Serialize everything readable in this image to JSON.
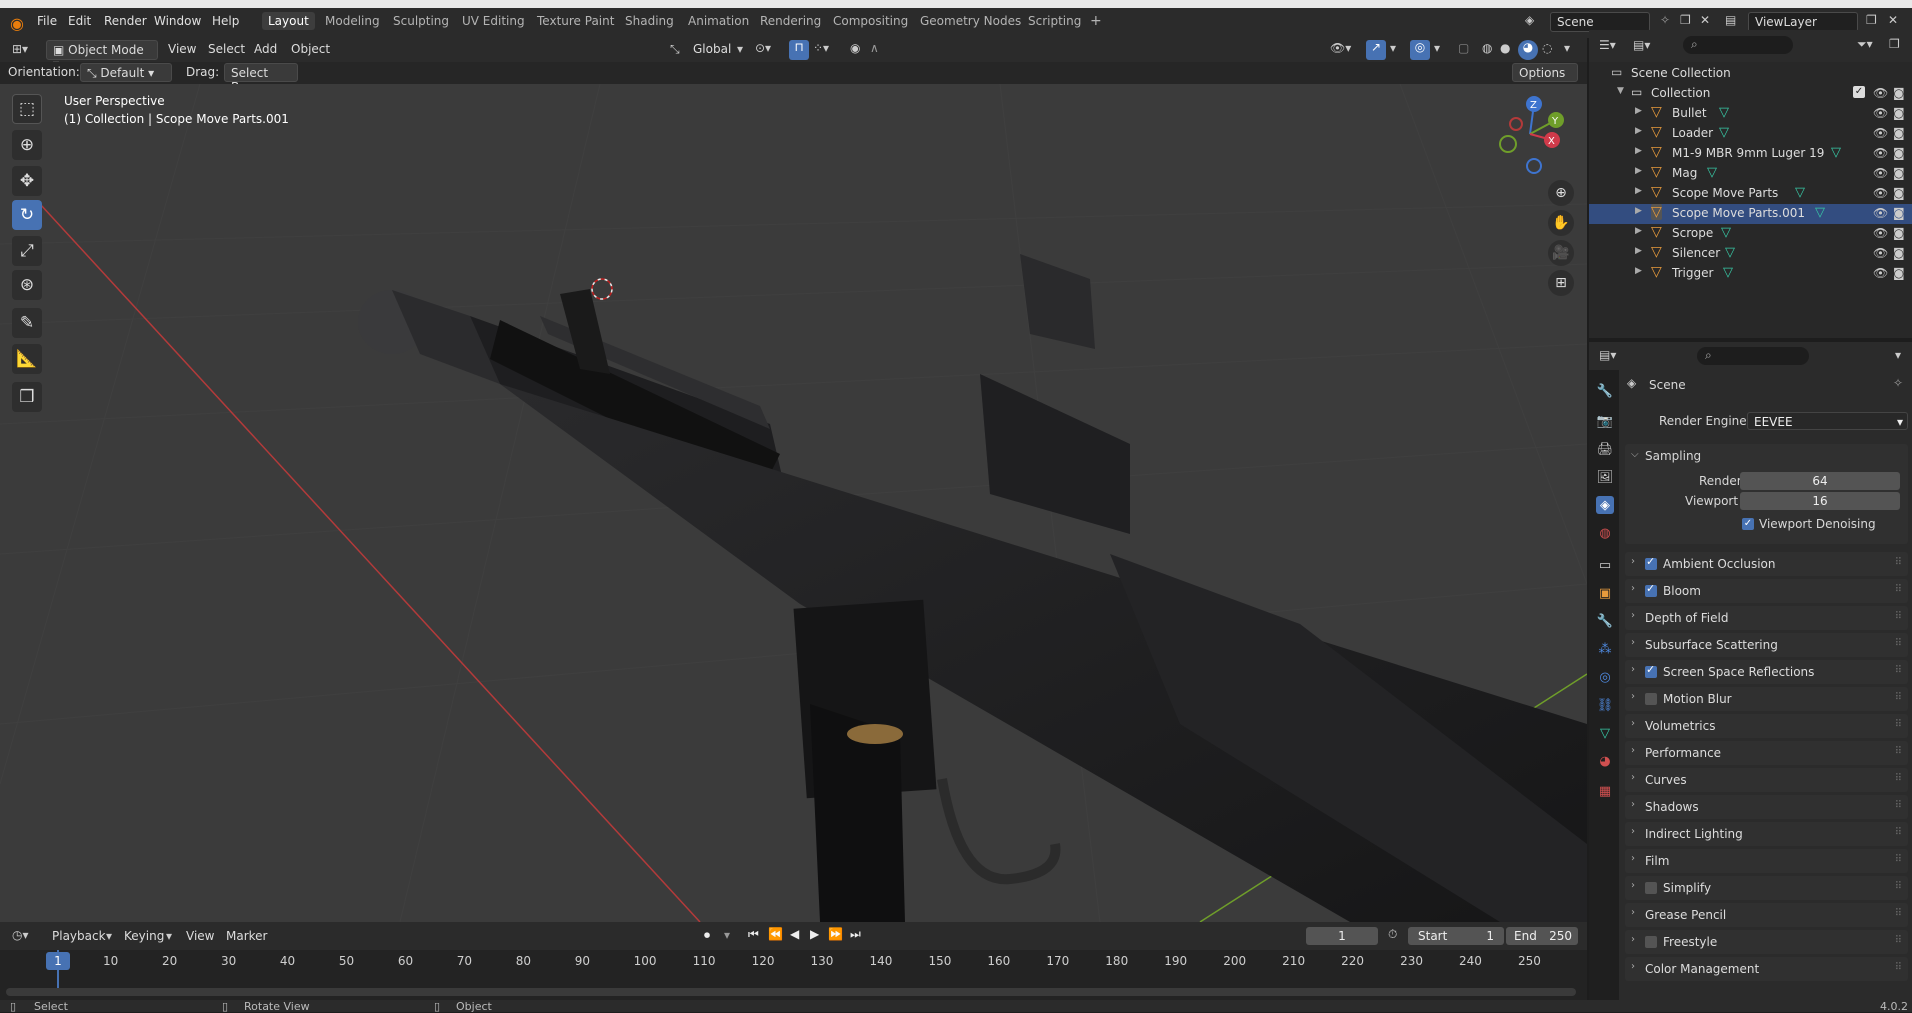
{
  "app": {
    "title": "Blender"
  },
  "menus": [
    "File",
    "Edit",
    "Render",
    "Window",
    "Help"
  ],
  "workspaces": [
    "Layout",
    "Modeling",
    "Sculpting",
    "UV Editing",
    "Texture Paint",
    "Shading",
    "Animation",
    "Rendering",
    "Compositing",
    "Geometry Nodes",
    "Scripting"
  ],
  "active_workspace": "Layout",
  "scene": {
    "name": "Scene",
    "view_layer": "ViewLayer"
  },
  "viewport_header": {
    "mode": "Object Mode",
    "menus": [
      "View",
      "Select",
      "Add",
      "Object"
    ],
    "transform_orientation": "Global",
    "orientation_label": "Orientation:",
    "orientation_value": "Default",
    "drag_label": "Drag:",
    "drag_value": "Select Box",
    "options": "Options"
  },
  "viewport": {
    "perspective": "User Perspective",
    "context": "(1) Collection | Scope Move Parts.001",
    "gizmo": {
      "z": "Z",
      "y": "Y",
      "x": "X"
    }
  },
  "tools": [
    "select-box-icon",
    "cursor-icon",
    "move-icon",
    "rotate-icon",
    "scale-icon",
    "transform-icon",
    "annotate-icon",
    "measure-icon",
    "add-cube-icon"
  ],
  "active_tool": "rotate-icon",
  "outliner": {
    "root": "Scene Collection",
    "collection": "Collection",
    "items": [
      {
        "name": "Bullet"
      },
      {
        "name": "Loader"
      },
      {
        "name": "M1-9 MBR 9mm Luger 19"
      },
      {
        "name": "Mag"
      },
      {
        "name": "Scope Move Parts"
      },
      {
        "name": "Scope Move Parts.001"
      },
      {
        "name": "Scrope"
      },
      {
        "name": "Silencer"
      },
      {
        "name": "Trigger"
      }
    ],
    "active_item": "Scope Move Parts.001"
  },
  "properties": {
    "context": "Scene",
    "render_engine_label": "Render Engine",
    "render_engine": "EEVEE",
    "sampling": {
      "label": "Sampling",
      "render_label": "Render",
      "render_value": "64",
      "viewport_label": "Viewport",
      "viewport_value": "16",
      "denoise_label": "Viewport Denoising",
      "denoise_checked": true
    },
    "panels": [
      {
        "label": "Ambient Occlusion",
        "checkbox": true,
        "checked": true
      },
      {
        "label": "Bloom",
        "checkbox": true,
        "checked": true
      },
      {
        "label": "Depth of Field",
        "checkbox": false,
        "checked": false
      },
      {
        "label": "Subsurface Scattering",
        "checkbox": false,
        "checked": false
      },
      {
        "label": "Screen Space Reflections",
        "checkbox": true,
        "checked": true
      },
      {
        "label": "Motion Blur",
        "checkbox": true,
        "checked": false
      },
      {
        "label": "Volumetrics",
        "checkbox": false,
        "checked": false
      },
      {
        "label": "Performance",
        "checkbox": false,
        "checked": false
      },
      {
        "label": "Curves",
        "checkbox": false,
        "checked": false
      },
      {
        "label": "Shadows",
        "checkbox": false,
        "checked": false
      },
      {
        "label": "Indirect Lighting",
        "checkbox": false,
        "checked": false
      },
      {
        "label": "Film",
        "checkbox": false,
        "checked": false
      },
      {
        "label": "Simplify",
        "checkbox": true,
        "checked": false
      },
      {
        "label": "Grease Pencil",
        "checkbox": false,
        "checked": false
      },
      {
        "label": "Freestyle",
        "checkbox": true,
        "checked": false
      },
      {
        "label": "Color Management",
        "checkbox": false,
        "checked": false
      }
    ]
  },
  "timeline": {
    "menus": [
      "Playback",
      "Keying",
      "View",
      "Marker"
    ],
    "current_frame": "1",
    "start_label": "Start",
    "start": "1",
    "end_label": "End",
    "end": "250",
    "ticks": [
      "1",
      "10",
      "20",
      "30",
      "40",
      "50",
      "60",
      "70",
      "80",
      "90",
      "100",
      "110",
      "120",
      "130",
      "140",
      "150",
      "160",
      "170",
      "180",
      "190",
      "200",
      "210",
      "220",
      "230",
      "240",
      "250"
    ]
  },
  "statusbar": {
    "select": "Select",
    "rotate": "Rotate View",
    "object": "Object",
    "version": "4.0.2"
  },
  "colors": {
    "accent": "#4772b3",
    "object": "#e69a3c",
    "mesh": "#38c9a6"
  }
}
